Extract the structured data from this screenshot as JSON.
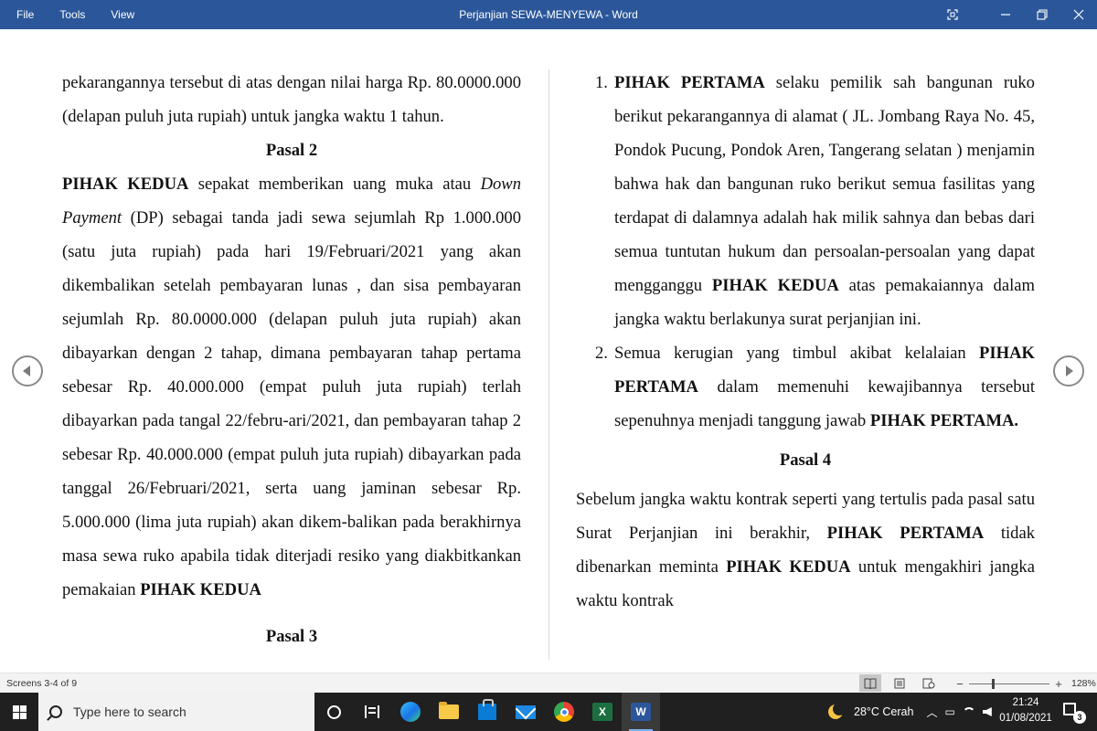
{
  "titlebar": {
    "menu": [
      "File",
      "Tools",
      "View"
    ],
    "title": "Perjanjian SEWA-MENYEWA  -  Word",
    "icons": [
      "fit-screen-icon",
      "minimize-icon",
      "restore-icon",
      "close-icon"
    ]
  },
  "document": {
    "left": {
      "p1": "pekarangannya tersebut di atas dengan nilai harga Rp. 80.0000.000 (delapan puluh juta rupiah) untuk jangka waktu 1 tahun.",
      "h_pasal2": "Pasal 2",
      "p2": {
        "lead": "PIHAK KEDUA",
        "t1": " sepakat memberikan uang muka atau ",
        "italic": "Down Payment",
        "t2": " (DP) sebagai tanda jadi sewa sejumlah Rp 1.000.000 (satu juta rupiah) pada hari 19/Februari/2021 yang akan dikembalikan setelah pembayaran lunas , dan sisa pembayaran sejumlah Rp. 80.0000.000 (delapan puluh juta rupiah) akan dibayarkan dengan 2 tahap, dimana pembayaran tahap pertama sebesar Rp. 40.000.000 (empat puluh juta rupiah) terlah dibayarkan pada tangal 22/febru-ari/2021, dan pembayaran tahap 2 sebesar Rp. 40.000.000 (empat puluh juta rupiah) dibayarkan pada tanggal 26/Februari/2021, serta uang jaminan sebesar Rp. 5.000.000 (lima juta rupiah) akan dikem-balikan pada berakhirnya masa sewa ruko apabila tidak diterjadi resiko yang diakbitkankan pemakaian ",
        "tail_bold": "PIHAK KEDUA"
      },
      "h_pasal3": "Pasal 3"
    },
    "right": {
      "item1": {
        "num": "1.",
        "lead": "PIHAK PERTAMA",
        "t1": " selaku pemilik sah bangunan ruko berikut pekarangannya di alamat ( JL. Jombang Raya No. 45, Pondok Pucung, Pondok Aren, Tangerang selatan )  menjamin bahwa hak dan bangunan ruko berikut semua fasilitas yang terdapat di dalamnya adalah hak milik sahnya dan bebas dari semua tuntutan hukum dan persoalan-persoalan yang dapat mengganggu ",
        "bold2": "PIHAK KEDUA",
        "t2": " atas pemakaiannya dalam jangka waktu berlakunya surat perjanjian ini."
      },
      "item2": {
        "num": "2.",
        "t1": "Semua kerugian yang timbul akibat kelalaian ",
        "bold1": "PIHAK PERTAMA",
        "t2": " dalam memenuhi kewajibannya tersebut sepenuhnya menjadi tanggung jawab ",
        "bold2": "PIHAK PERTAMA."
      },
      "h_pasal4": "Pasal 4",
      "p4": {
        "t1": "Sebelum jangka waktu kontrak seperti yang tertulis pada pasal satu Surat Perjanjian ini berakhir, ",
        "bold1": "PIHAK PERTAMA",
        "t2": " tidak dibenarkan meminta ",
        "bold2": "PIHAK KEDUA",
        "t3": " untuk mengakhiri jangka waktu kontrak"
      }
    }
  },
  "statusbar": {
    "screens": "Screens 3-4 of 9",
    "zoom_minus": "−",
    "zoom_plus": "+",
    "zoom_percent": "128%",
    "zoom_fraction": 0.28
  },
  "taskbar": {
    "search_placeholder": "Type here to search",
    "weather": "28°C  Cerah",
    "time": "21:24",
    "date": "01/08/2021",
    "notification_count": "3",
    "apps": [
      "cortana-icon",
      "task-view-icon",
      "edge-icon",
      "file-explorer-icon",
      "store-icon",
      "mail-icon",
      "chrome-icon",
      "excel-icon",
      "word-icon"
    ]
  }
}
